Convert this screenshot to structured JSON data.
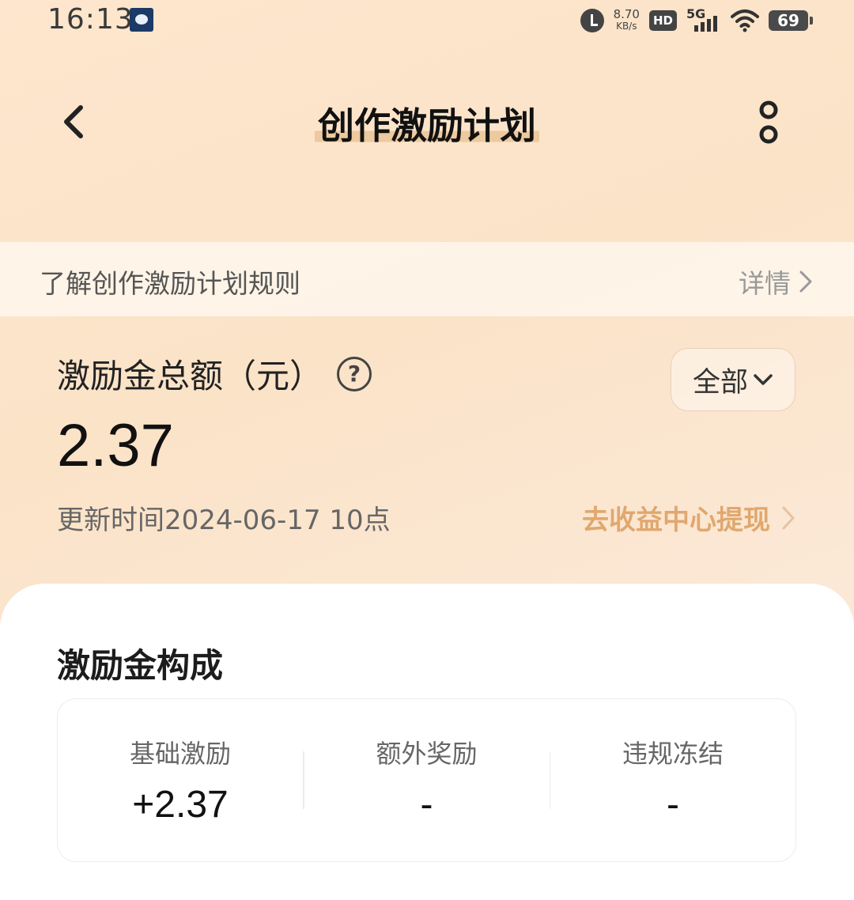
{
  "status_bar": {
    "time": "16:13",
    "net_speed_value": "8.70",
    "net_speed_unit": "KB/s",
    "hd_label": "HD",
    "network_label": "5G",
    "battery_level": "69",
    "icons": [
      "app-notification-icon",
      "alarm-icon",
      "hd-icon",
      "signal-icon",
      "wifi-icon",
      "battery-icon"
    ]
  },
  "header": {
    "title": "创作激励计划",
    "back_icon": "chevron-left-icon",
    "more_icon": "more-vertical-icon"
  },
  "rules_banner": {
    "text": "了解创作激励计划规则",
    "detail_label": "详情"
  },
  "summary": {
    "total_label": "激励金总额（元）",
    "total_amount": "2.37",
    "filter_label": "全部",
    "update_time": "更新时间2024-06-17 10点",
    "withdraw_label": "去收益中心提现"
  },
  "composition": {
    "title": "激励金构成",
    "items": [
      {
        "label": "基础激励",
        "value": "+2.37"
      },
      {
        "label": "额外奖励",
        "value": "-"
      },
      {
        "label": "违规冻结",
        "value": "-"
      }
    ]
  },
  "colors": {
    "accent": "#e0a86e",
    "background_start": "#fde6cd",
    "background_end": "#fcefe2",
    "card": "#ffffff"
  }
}
